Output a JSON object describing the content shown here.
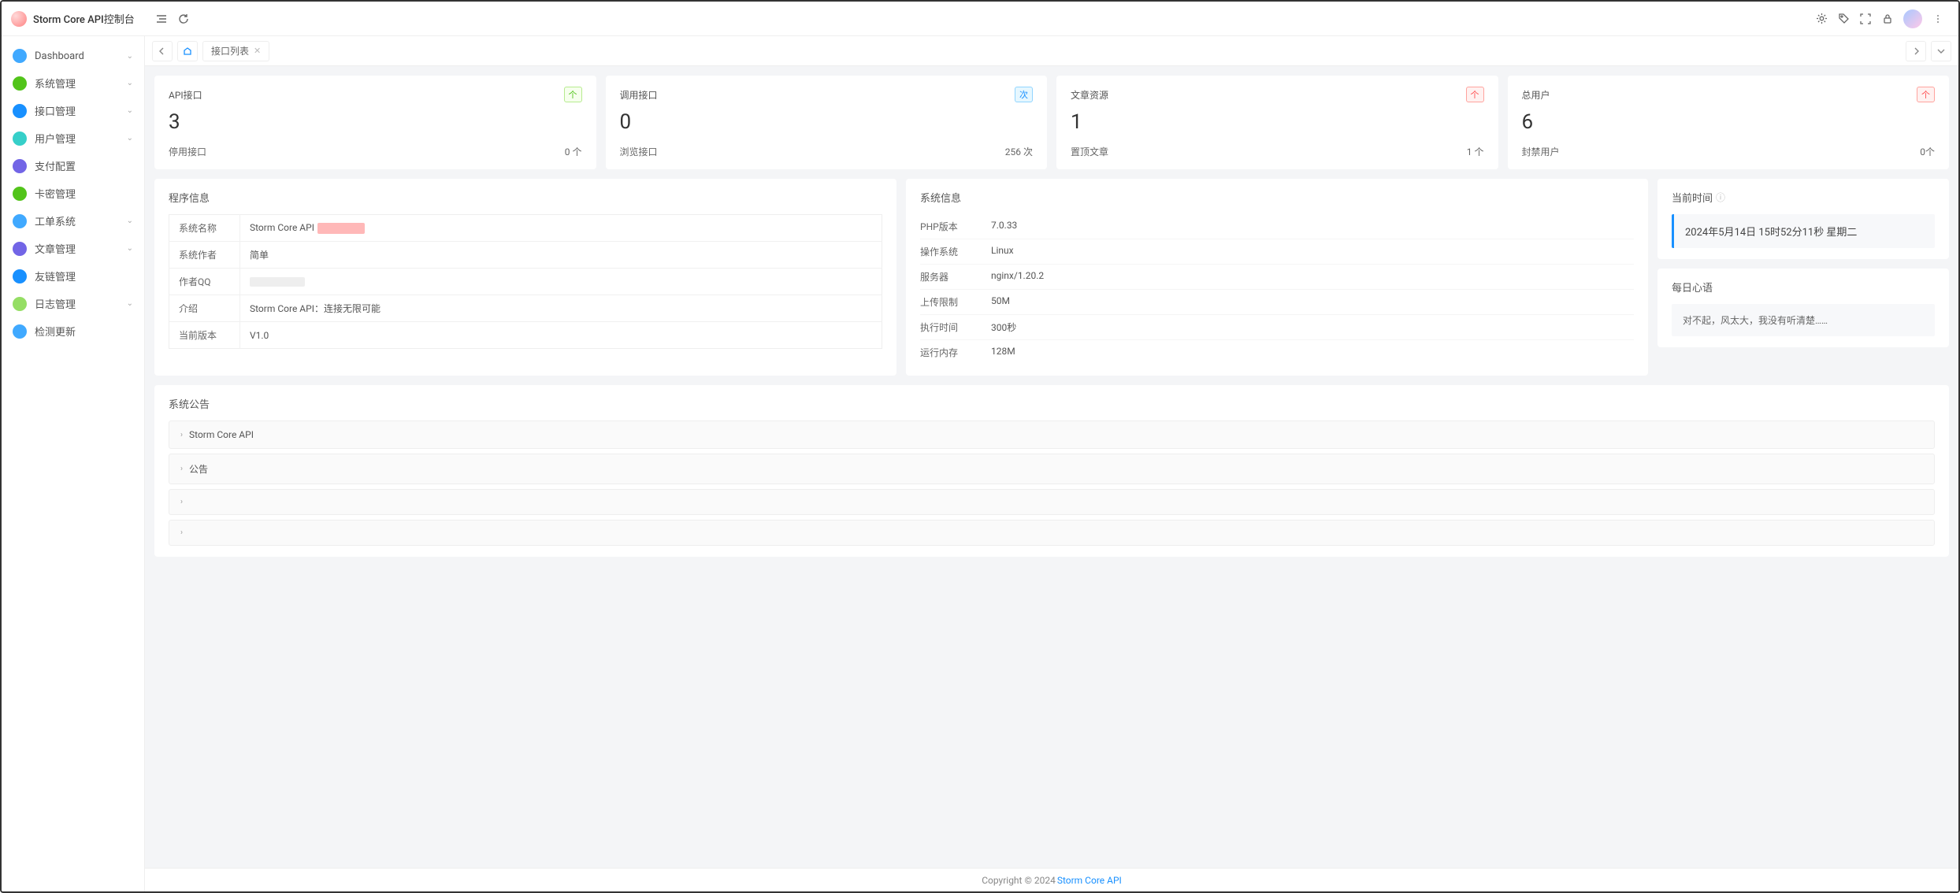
{
  "brand": "Storm Core API控制台",
  "sidebar": {
    "items": [
      {
        "label": "Dashboard",
        "color": "#40a9ff",
        "expandable": true
      },
      {
        "label": "系统管理",
        "color": "#52c41a",
        "expandable": true
      },
      {
        "label": "接口管理",
        "color": "#1890ff",
        "expandable": true
      },
      {
        "label": "用户管理",
        "color": "#36cfc9",
        "expandable": true
      },
      {
        "label": "支付配置",
        "color": "#7265e6",
        "expandable": false
      },
      {
        "label": "卡密管理",
        "color": "#52c41a",
        "expandable": false
      },
      {
        "label": "工单系统",
        "color": "#40a9ff",
        "expandable": true
      },
      {
        "label": "文章管理",
        "color": "#7265e6",
        "expandable": true
      },
      {
        "label": "友链管理",
        "color": "#1890ff",
        "expandable": false
      },
      {
        "label": "日志管理",
        "color": "#95de64",
        "expandable": true
      },
      {
        "label": "检测更新",
        "color": "#40a9ff",
        "expandable": false
      }
    ]
  },
  "tabs": {
    "active": "接口列表"
  },
  "stats": [
    {
      "title": "API接口",
      "badge": "个",
      "badge_cls": "badge-green",
      "value": "3",
      "sub_label": "停用接口",
      "sub_value": "0 个"
    },
    {
      "title": "调用接口",
      "badge": "次",
      "badge_cls": "badge-blue",
      "value": "0",
      "sub_label": "浏览接口",
      "sub_value": "256 次"
    },
    {
      "title": "文章资源",
      "badge": "个",
      "badge_cls": "badge-red",
      "value": "1",
      "sub_label": "置顶文章",
      "sub_value": "1 个"
    },
    {
      "title": "总用户",
      "badge": "个",
      "badge_cls": "badge-red",
      "value": "6",
      "sub_label": "封禁用户",
      "sub_value": "0个"
    }
  ],
  "program_info": {
    "title": "程序信息",
    "rows": [
      {
        "k": "系统名称",
        "v": "Storm Core API",
        "redact": true
      },
      {
        "k": "系统作者",
        "v": "简单"
      },
      {
        "k": "作者QQ",
        "v": "",
        "redact_gray": true
      },
      {
        "k": "介绍",
        "v": "Storm Core API：连接无限可能"
      },
      {
        "k": "当前版本",
        "v": "V1.0"
      }
    ]
  },
  "system_info": {
    "title": "系统信息",
    "rows": [
      {
        "k": "PHP版本",
        "v": "7.0.33"
      },
      {
        "k": "操作系统",
        "v": "Linux"
      },
      {
        "k": "服务器",
        "v": "nginx/1.20.2"
      },
      {
        "k": "上传限制",
        "v": "50M"
      },
      {
        "k": "执行时间",
        "v": "300秒"
      },
      {
        "k": "运行内存",
        "v": "128M"
      }
    ]
  },
  "clock": {
    "title": "当前时间",
    "text": "2024年5月14日 15时52分11秒 星期二"
  },
  "quote": {
    "title": "每日心语",
    "text": "对不起，风太大，我没有听清楚……"
  },
  "announce": {
    "title": "系统公告",
    "items": [
      {
        "label": "Storm Core API"
      },
      {
        "label": "公告"
      },
      {
        "label": ""
      },
      {
        "label": ""
      }
    ]
  },
  "footer": {
    "copyright": "Copyright © 2024",
    "link": "Storm Core API"
  }
}
